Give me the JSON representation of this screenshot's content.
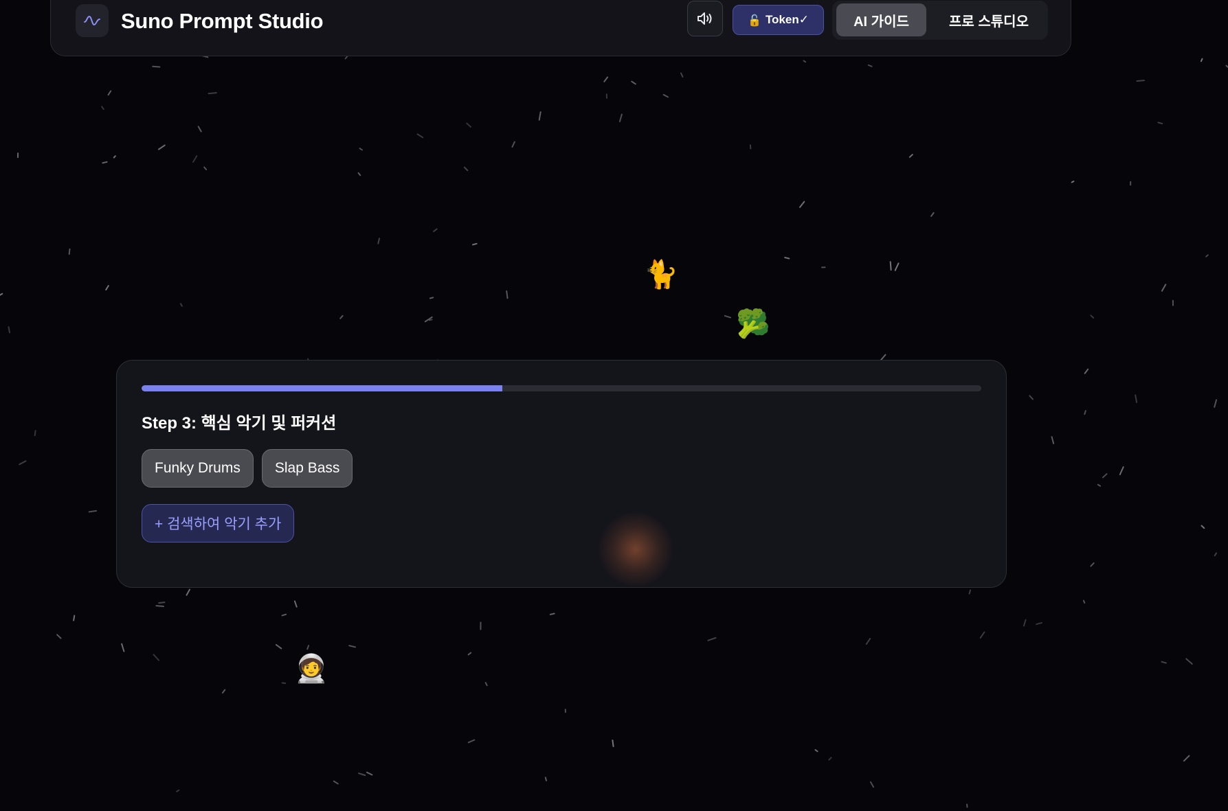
{
  "header": {
    "app_title": "Suno Prompt Studio",
    "logo_icon": "waveform-icon",
    "sound_icon": "speaker-icon",
    "token_label": "Token✓",
    "token_icon": "unlocked-icon",
    "modes": [
      {
        "label": "AI 가이드",
        "active": true
      },
      {
        "label": "프로 스튜디오",
        "active": false
      }
    ]
  },
  "wizard": {
    "progress": 0.43,
    "step_title": "Step 3: 핵심 악기 및 퍼커션",
    "chips": [
      {
        "label": "Funky Drums"
      },
      {
        "label": "Slap Bass"
      }
    ],
    "add_button_label": "+ 검색하여 악기 추가"
  },
  "decorations": {
    "emojis": [
      "🐈",
      "🥦",
      "🧑‍🚀"
    ]
  },
  "colors": {
    "background": "#06060a",
    "accent": "#7b82ef",
    "token_bg": "#2d3168",
    "chip_bg": "#4a4a51"
  }
}
